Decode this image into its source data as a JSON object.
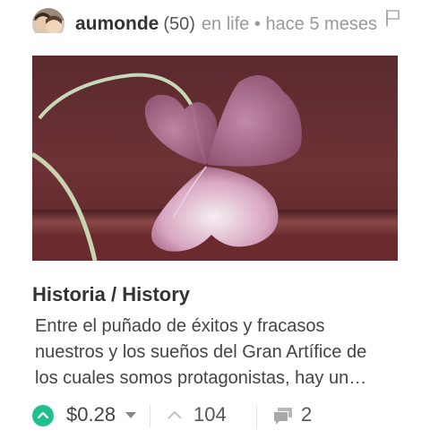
{
  "post": {
    "author": "aumonde",
    "reputation": "(50)",
    "category": "en life",
    "separator": "•",
    "time_ago": "hace 5 meses",
    "title": "Historia / History",
    "summary_lines": [
      "Entre el puñado de éxitos y fracasos",
      "nuestros y los sueños del Gran Artífice de",
      "los cuales somos protagonistas, hay un…"
    ],
    "payout": "$0.28",
    "votes": "104",
    "comments": "2"
  },
  "icons": {
    "flag": "flag-icon",
    "upvote": "upvote-icon",
    "payout_dropdown": "caret-down-icon",
    "votes": "chevron-up-icon",
    "comments": "comments-icon"
  },
  "colors": {
    "upvote": "#1fbf8f",
    "text_primary": "#333333",
    "text_muted": "#999999"
  }
}
